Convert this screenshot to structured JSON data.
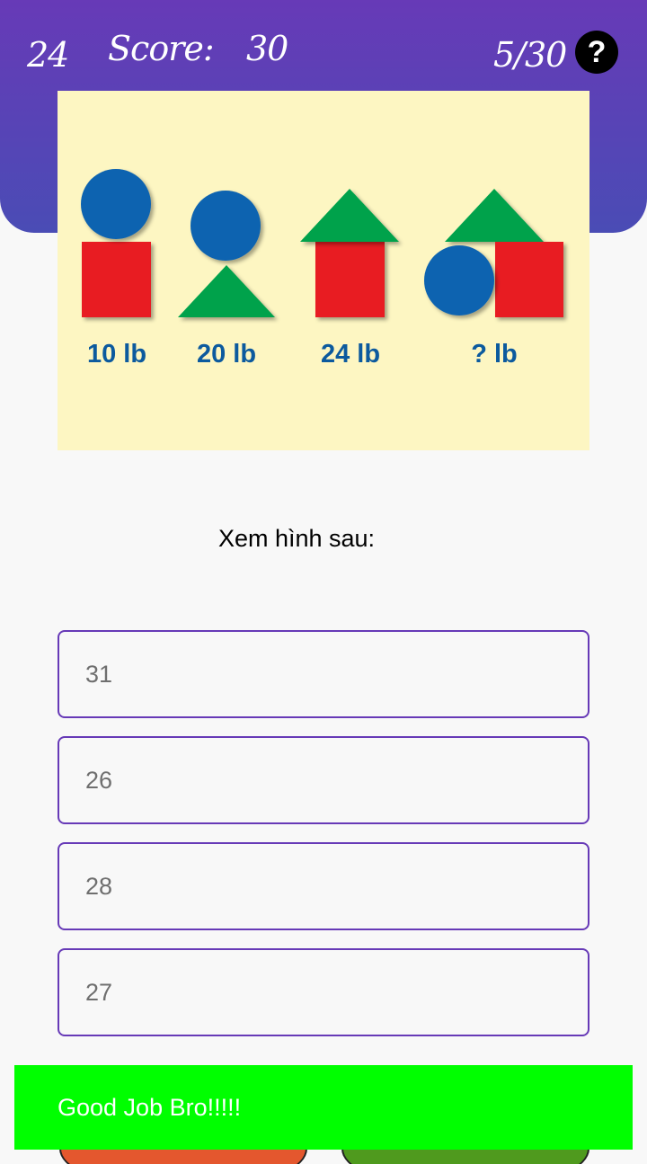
{
  "header": {
    "timer": "24",
    "score_label": "Score:",
    "score_value": "30",
    "progress": "5/30",
    "help_icon": "?",
    "colors": {
      "gradient_top": "#673ab7",
      "gradient_bottom": "#4a4cb5"
    }
  },
  "puzzle": {
    "labels": [
      "10 lb",
      "20 lb",
      "24 lb",
      "? lb"
    ],
    "colors": {
      "background": "#fdf6c2",
      "circle": "#0a63b0",
      "square": "#e81c24",
      "triangle": "#04a24c"
    }
  },
  "question": "Xem hình sau:",
  "answers": [
    "31",
    "26",
    "28",
    "27"
  ],
  "toast": "Good Job Bro!!!!!",
  "toast_color": "#00ff00",
  "bottom_buttons": {
    "left_color": "#e4572e",
    "right_color": "#4f9a1e"
  }
}
